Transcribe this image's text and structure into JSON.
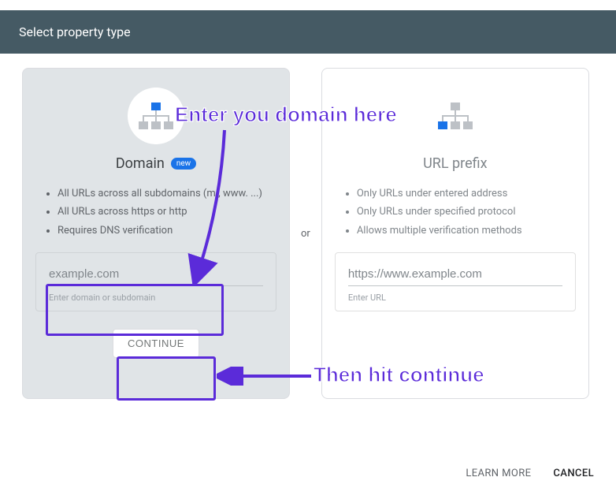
{
  "header": {
    "title": "Select property type"
  },
  "separator": "or",
  "domain_card": {
    "title": "Domain",
    "badge": "new",
    "bullets": [
      "All URLs across all subdomains (m., www. ...)",
      "All URLs across https or http",
      "Requires DNS verification"
    ],
    "input_placeholder": "example.com",
    "input_helper": "Enter domain or subdomain",
    "continue_label": "CONTINUE"
  },
  "url_card": {
    "title": "URL prefix",
    "bullets": [
      "Only URLs under entered address",
      "Only URLs under specified protocol",
      "Allows multiple verification methods"
    ],
    "input_placeholder": "https://www.example.com",
    "input_helper": "Enter URL"
  },
  "footer": {
    "learn_more": "LEARN MORE",
    "cancel": "CANCEL"
  },
  "annotations": {
    "enter_domain": "Enter you domain here",
    "hit_continue": "Then hit continue"
  },
  "colors": {
    "accent": "#5b2bd9",
    "badge": "#1a73e8",
    "header_bg": "#455a64"
  }
}
